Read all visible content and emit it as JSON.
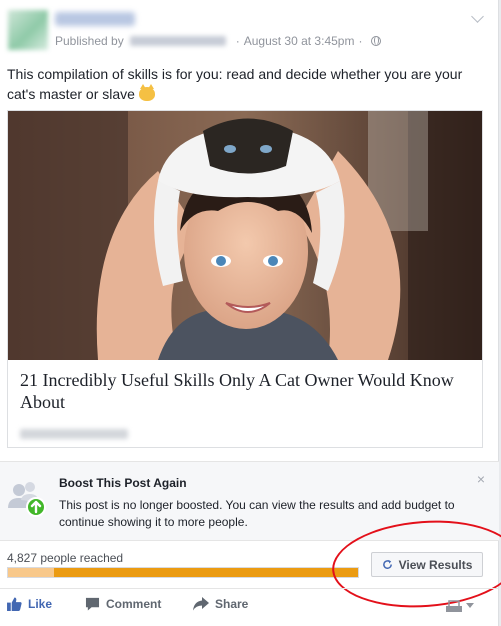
{
  "post": {
    "published_by_prefix": "Published by",
    "date": "August 30 at 3:45pm",
    "text": "This compilation of skills is for you: read and decide whether you are your cat's master or slave",
    "emoji_icon": "cat-face-emoji"
  },
  "link": {
    "title": "21 Incredibly Useful Skills Only A Cat Owner Would Know About"
  },
  "boost": {
    "title": "Boost This Post Again",
    "body": "This post is no longer boosted. You can view the results and add budget to continue showing it to more people.",
    "close_label": "×",
    "icon": "boost-people-arrow-icon",
    "accent": "#42b72a"
  },
  "reach": {
    "label": "4,827 people reached",
    "organic_fraction": 0.13,
    "paid_fraction": 0.87,
    "organic_color": "#f8c88a",
    "paid_color": "#eb9b12"
  },
  "view_results": {
    "label": "View Results",
    "icon": "refresh-icon"
  },
  "actions": {
    "like": "Like",
    "comment": "Comment",
    "share": "Share"
  },
  "colors": {
    "brand_blue": "#4267b2",
    "annotation_red": "#e3101a"
  }
}
